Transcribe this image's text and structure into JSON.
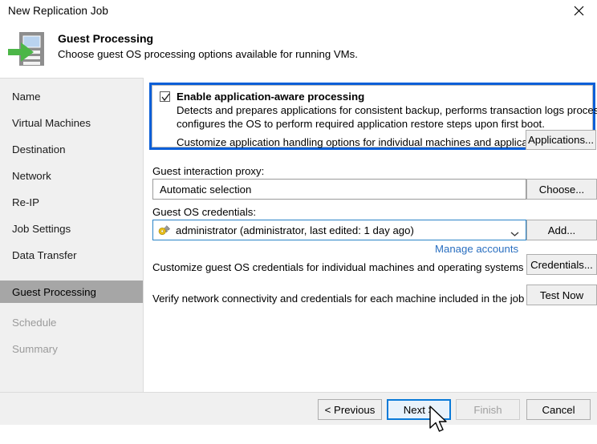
{
  "window": {
    "title": "New Replication Job",
    "close_label": "✕"
  },
  "header": {
    "icon": "server-arrow-icon",
    "title": "Guest Processing",
    "subtitle": "Choose guest OS processing options available for running VMs."
  },
  "sidebar": {
    "items": [
      {
        "label": "Name",
        "state": "normal"
      },
      {
        "label": "Virtual Machines",
        "state": "normal"
      },
      {
        "label": "Destination",
        "state": "normal"
      },
      {
        "label": "Network",
        "state": "normal"
      },
      {
        "label": "Re-IP",
        "state": "normal"
      },
      {
        "label": "Job Settings",
        "state": "normal"
      },
      {
        "label": "Data Transfer",
        "state": "normal"
      },
      {
        "label": "Guest Processing",
        "state": "selected"
      },
      {
        "label": "Schedule",
        "state": "disabled"
      },
      {
        "label": "Summary",
        "state": "disabled"
      }
    ]
  },
  "main": {
    "app_aware": {
      "checkbox_label": "Enable application-aware processing",
      "checked": true,
      "description_line1": "Detects and prepares applications for consistent backup, performs transaction logs processing, and",
      "description_line2": "configures the OS to perform required application restore steps upon first boot.",
      "customize_text": "Customize application handling options for individual machines and applications",
      "applications_button": "Applications...",
      "highlight_color": "#0a5fd8"
    },
    "proxy": {
      "label": "Guest interaction proxy:",
      "value": "Automatic selection",
      "choose_button": "Choose..."
    },
    "credentials": {
      "label": "Guest OS credentials:",
      "value": "administrator (administrator, last edited: 1 day ago)",
      "icon": "key-icon",
      "add_button": "Add...",
      "manage_link": "Manage accounts",
      "link_color": "#2a6fc0"
    },
    "customize_row": {
      "text": "Customize guest OS credentials for individual machines and operating systems",
      "button": "Credentials..."
    },
    "verify_row": {
      "text": "Verify network connectivity and credentials for each machine included in the job",
      "button": "Test Now"
    }
  },
  "footer": {
    "previous": "< Previous",
    "next": "Next >",
    "finish": "Finish",
    "cancel": "Cancel",
    "next_focused": true,
    "finish_disabled": true
  }
}
